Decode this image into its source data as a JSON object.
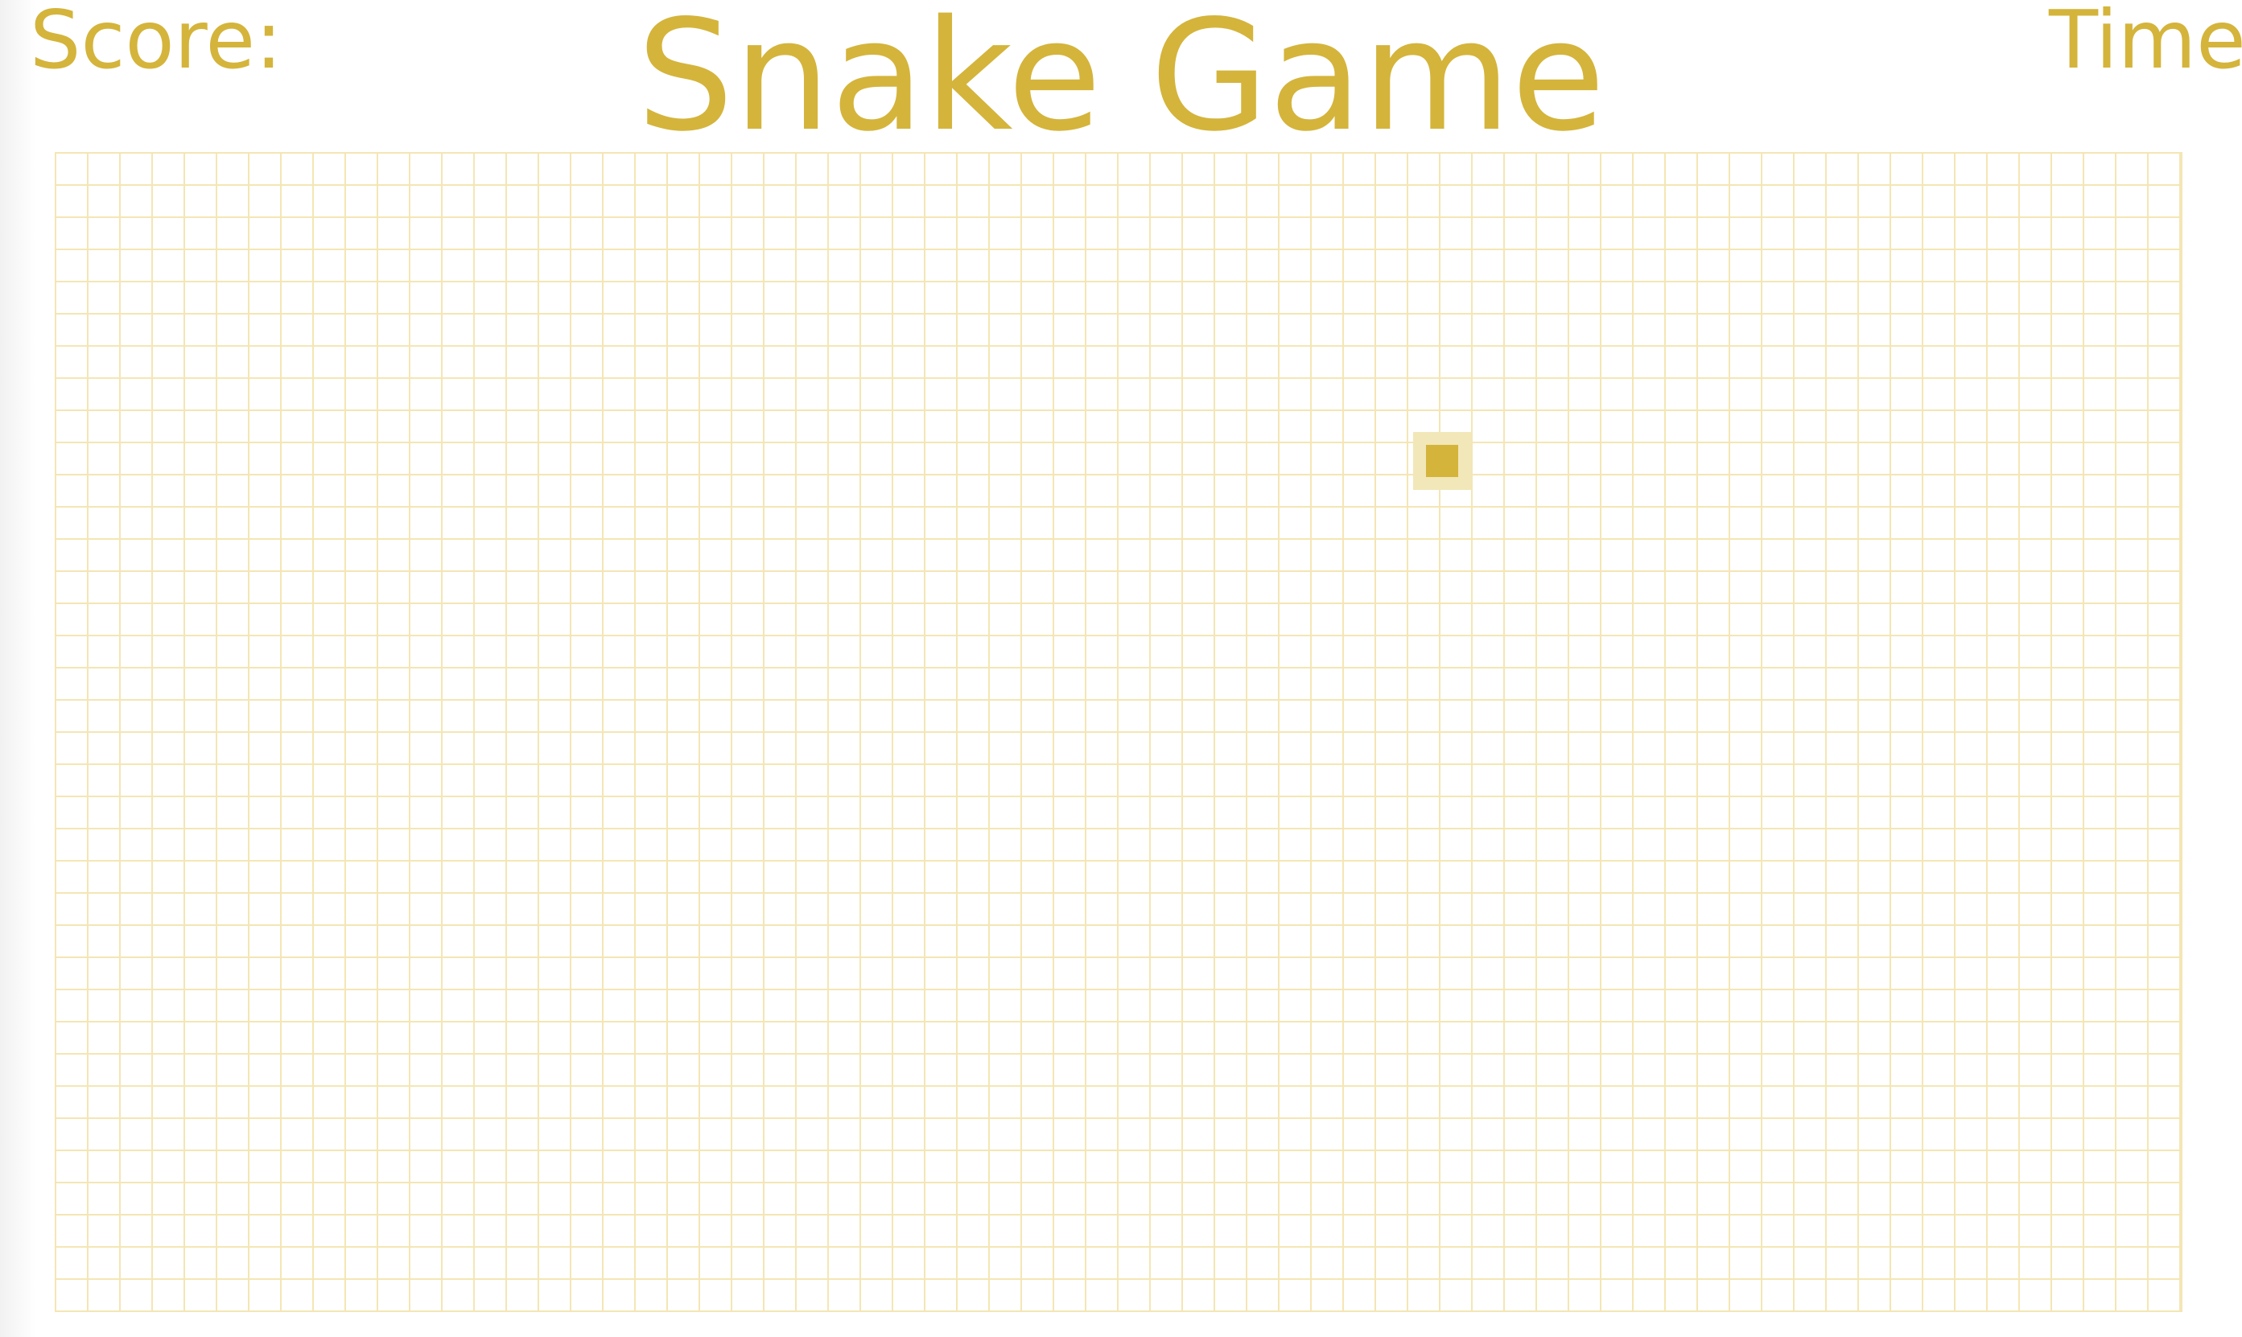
{
  "title": "Snake Game",
  "hud": {
    "score_label": "Score:",
    "time_label": "Time"
  },
  "colors": {
    "accent": "#d4b43b",
    "grid_line": "#f4e6b4",
    "food_glow": "#f2e7b8",
    "background": "#ffffff"
  }
}
